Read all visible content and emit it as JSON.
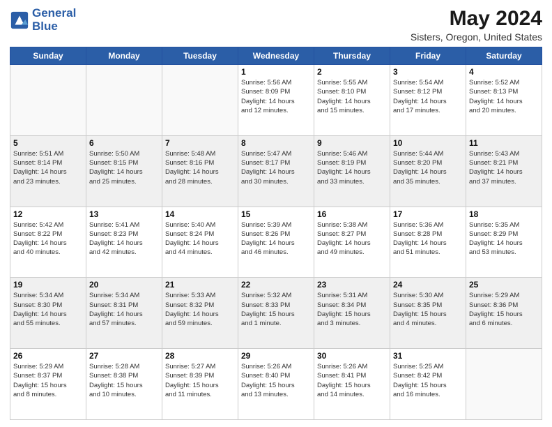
{
  "header": {
    "logo_line1": "General",
    "logo_line2": "Blue",
    "main_title": "May 2024",
    "subtitle": "Sisters, Oregon, United States"
  },
  "days_of_week": [
    "Sunday",
    "Monday",
    "Tuesday",
    "Wednesday",
    "Thursday",
    "Friday",
    "Saturday"
  ],
  "weeks": [
    [
      {
        "day": "",
        "info": ""
      },
      {
        "day": "",
        "info": ""
      },
      {
        "day": "",
        "info": ""
      },
      {
        "day": "1",
        "info": "Sunrise: 5:56 AM\nSunset: 8:09 PM\nDaylight: 14 hours\nand 12 minutes."
      },
      {
        "day": "2",
        "info": "Sunrise: 5:55 AM\nSunset: 8:10 PM\nDaylight: 14 hours\nand 15 minutes."
      },
      {
        "day": "3",
        "info": "Sunrise: 5:54 AM\nSunset: 8:12 PM\nDaylight: 14 hours\nand 17 minutes."
      },
      {
        "day": "4",
        "info": "Sunrise: 5:52 AM\nSunset: 8:13 PM\nDaylight: 14 hours\nand 20 minutes."
      }
    ],
    [
      {
        "day": "5",
        "info": "Sunrise: 5:51 AM\nSunset: 8:14 PM\nDaylight: 14 hours\nand 23 minutes."
      },
      {
        "day": "6",
        "info": "Sunrise: 5:50 AM\nSunset: 8:15 PM\nDaylight: 14 hours\nand 25 minutes."
      },
      {
        "day": "7",
        "info": "Sunrise: 5:48 AM\nSunset: 8:16 PM\nDaylight: 14 hours\nand 28 minutes."
      },
      {
        "day": "8",
        "info": "Sunrise: 5:47 AM\nSunset: 8:17 PM\nDaylight: 14 hours\nand 30 minutes."
      },
      {
        "day": "9",
        "info": "Sunrise: 5:46 AM\nSunset: 8:19 PM\nDaylight: 14 hours\nand 33 minutes."
      },
      {
        "day": "10",
        "info": "Sunrise: 5:44 AM\nSunset: 8:20 PM\nDaylight: 14 hours\nand 35 minutes."
      },
      {
        "day": "11",
        "info": "Sunrise: 5:43 AM\nSunset: 8:21 PM\nDaylight: 14 hours\nand 37 minutes."
      }
    ],
    [
      {
        "day": "12",
        "info": "Sunrise: 5:42 AM\nSunset: 8:22 PM\nDaylight: 14 hours\nand 40 minutes."
      },
      {
        "day": "13",
        "info": "Sunrise: 5:41 AM\nSunset: 8:23 PM\nDaylight: 14 hours\nand 42 minutes."
      },
      {
        "day": "14",
        "info": "Sunrise: 5:40 AM\nSunset: 8:24 PM\nDaylight: 14 hours\nand 44 minutes."
      },
      {
        "day": "15",
        "info": "Sunrise: 5:39 AM\nSunset: 8:26 PM\nDaylight: 14 hours\nand 46 minutes."
      },
      {
        "day": "16",
        "info": "Sunrise: 5:38 AM\nSunset: 8:27 PM\nDaylight: 14 hours\nand 49 minutes."
      },
      {
        "day": "17",
        "info": "Sunrise: 5:36 AM\nSunset: 8:28 PM\nDaylight: 14 hours\nand 51 minutes."
      },
      {
        "day": "18",
        "info": "Sunrise: 5:35 AM\nSunset: 8:29 PM\nDaylight: 14 hours\nand 53 minutes."
      }
    ],
    [
      {
        "day": "19",
        "info": "Sunrise: 5:34 AM\nSunset: 8:30 PM\nDaylight: 14 hours\nand 55 minutes."
      },
      {
        "day": "20",
        "info": "Sunrise: 5:34 AM\nSunset: 8:31 PM\nDaylight: 14 hours\nand 57 minutes."
      },
      {
        "day": "21",
        "info": "Sunrise: 5:33 AM\nSunset: 8:32 PM\nDaylight: 14 hours\nand 59 minutes."
      },
      {
        "day": "22",
        "info": "Sunrise: 5:32 AM\nSunset: 8:33 PM\nDaylight: 15 hours\nand 1 minute."
      },
      {
        "day": "23",
        "info": "Sunrise: 5:31 AM\nSunset: 8:34 PM\nDaylight: 15 hours\nand 3 minutes."
      },
      {
        "day": "24",
        "info": "Sunrise: 5:30 AM\nSunset: 8:35 PM\nDaylight: 15 hours\nand 4 minutes."
      },
      {
        "day": "25",
        "info": "Sunrise: 5:29 AM\nSunset: 8:36 PM\nDaylight: 15 hours\nand 6 minutes."
      }
    ],
    [
      {
        "day": "26",
        "info": "Sunrise: 5:29 AM\nSunset: 8:37 PM\nDaylight: 15 hours\nand 8 minutes."
      },
      {
        "day": "27",
        "info": "Sunrise: 5:28 AM\nSunset: 8:38 PM\nDaylight: 15 hours\nand 10 minutes."
      },
      {
        "day": "28",
        "info": "Sunrise: 5:27 AM\nSunset: 8:39 PM\nDaylight: 15 hours\nand 11 minutes."
      },
      {
        "day": "29",
        "info": "Sunrise: 5:26 AM\nSunset: 8:40 PM\nDaylight: 15 hours\nand 13 minutes."
      },
      {
        "day": "30",
        "info": "Sunrise: 5:26 AM\nSunset: 8:41 PM\nDaylight: 15 hours\nand 14 minutes."
      },
      {
        "day": "31",
        "info": "Sunrise: 5:25 AM\nSunset: 8:42 PM\nDaylight: 15 hours\nand 16 minutes."
      },
      {
        "day": "",
        "info": ""
      }
    ]
  ]
}
